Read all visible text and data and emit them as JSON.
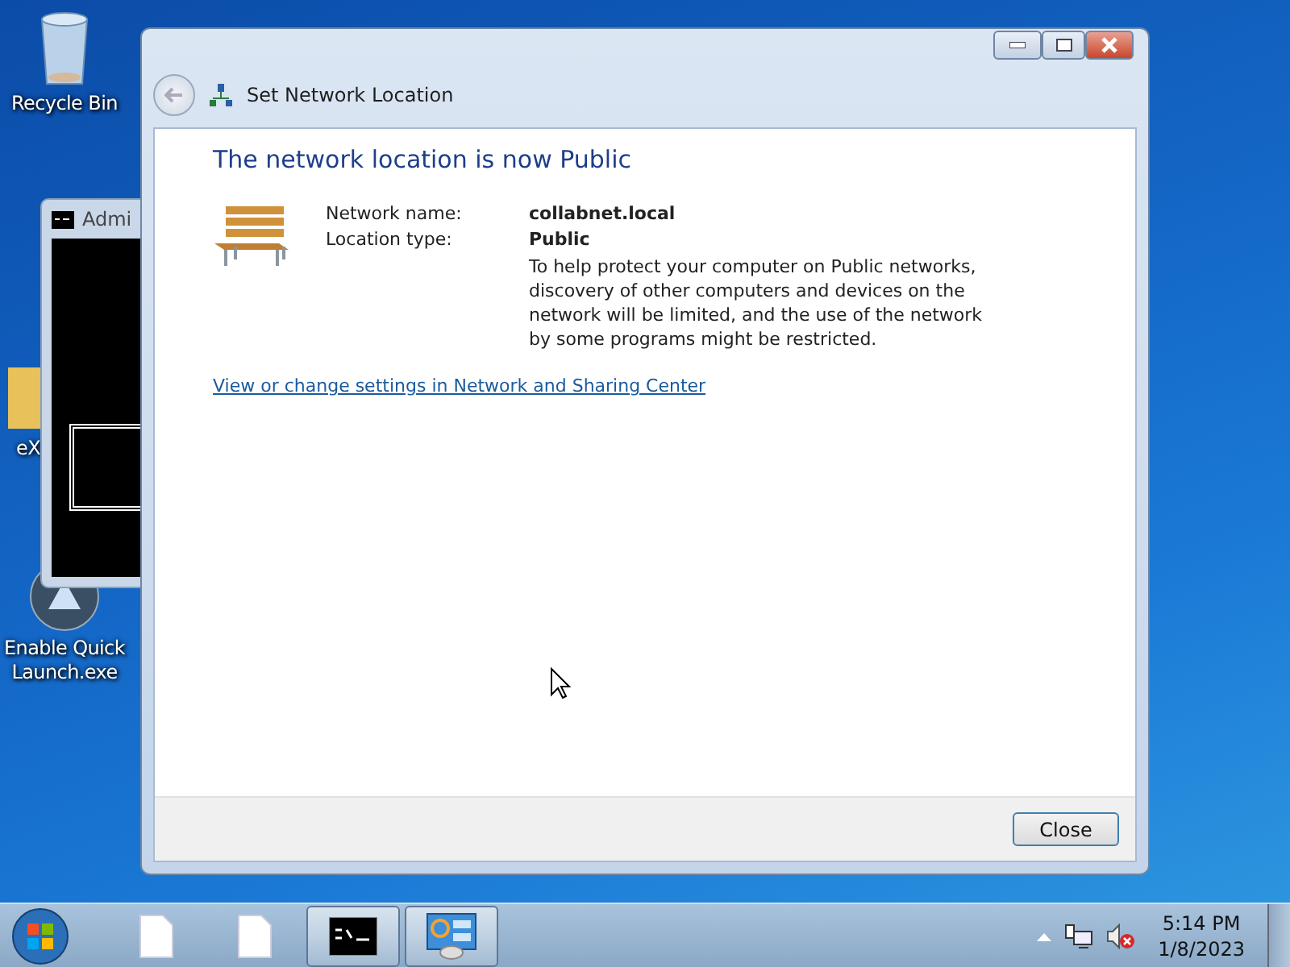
{
  "desktop": {
    "icons": [
      {
        "kind": "recycle-bin",
        "label": "Recycle Bin"
      },
      {
        "kind": "folder",
        "label": "eX"
      },
      {
        "kind": "app",
        "label": "Enable Quick Launch.exe"
      }
    ]
  },
  "console_window": {
    "title": "Admi"
  },
  "dialog": {
    "title": "Set Network Location",
    "heading": "The network location is now Public",
    "fields": [
      {
        "label": "Network name:",
        "value": "collabnet.local"
      },
      {
        "label": "Location type:",
        "value": "Public"
      }
    ],
    "description": "To help protect your computer on Public networks, discovery of other computers and devices on the network will be limited, and the use of the network by some programs might be restricted.",
    "link": "View or change settings in Network and Sharing Center",
    "close_button": "Close"
  },
  "taskbar": {
    "items": [
      {
        "kind": "document",
        "open": false
      },
      {
        "kind": "document",
        "open": false
      },
      {
        "kind": "console",
        "open": true
      },
      {
        "kind": "network",
        "open": true
      }
    ],
    "tray": {
      "time": "5:14 PM",
      "date": "1/8/2023"
    }
  }
}
